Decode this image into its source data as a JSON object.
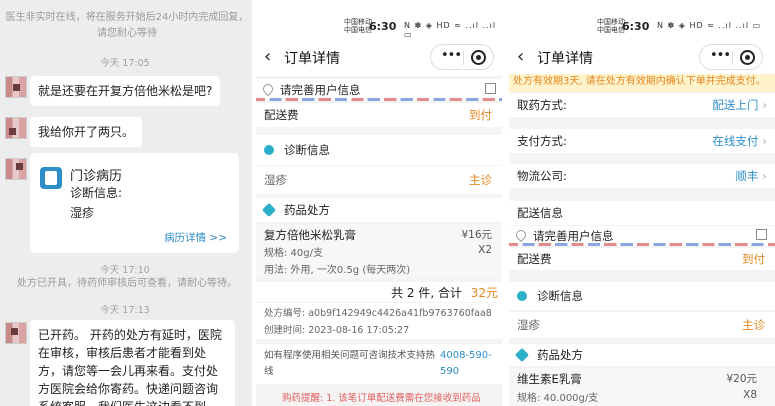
{
  "chat": {
    "notice": "医生非实时在线，将在服务开始后24小时内完成回复，请您耐心等待",
    "time1": "今天 17:05",
    "msg1": "就是还要在开复方倍他米松是吧?",
    "msg2": "我给你开了两只。",
    "card_title": "门诊病历",
    "card_label": "诊断信息:",
    "card_diag": "湿疹",
    "card_link": "病历详情 >>",
    "time2": "今天 17:10",
    "notice2": "处方已开具，待药师审核后可查看，请耐心等待。",
    "time3": "今天 17:13",
    "msg3": "已开药。 开药的处方有延时，医院在审核，审核后患者才能看到处方，请您等一会儿再来看。支付处方医院会给你寄药。快递问题咨询系统客服，我们医生这边看不到。系统提"
  },
  "status": {
    "carrier1": "中国移动",
    "carrier2": "中国电信",
    "time": "6:30",
    "icons": "N ✽ ◈ HD ≈ ..ıl ..ıl ▭"
  },
  "order": {
    "title": "订单详情",
    "back": "‹",
    "menu": "•••",
    "address": "请完善用户信息",
    "delivery_fee_label": "配送费",
    "delivery_fee_value": "到付",
    "diag_section": "诊断信息",
    "diag_name": "湿疹",
    "diag_tag": "主诊",
    "rx_section": "药品处方",
    "drug1_name": "复方倍他米松乳膏",
    "drug1_price": "¥16元",
    "drug1_spec": "规格: 40g/支",
    "drug1_qty": "X2",
    "drug1_usage": "用法: 外用, 一次0.5g (每天两次)",
    "total_label": "共 2 件, 合计",
    "total_value": "32元",
    "rx_no": "处方编号: a0b9f142949c4426a41fb9763760faa8",
    "created": "创建时间:   2023-08-16 17:05:27",
    "help_text": "如有程序使用相关问题可咨询技术支持热线",
    "help_phone": "4008-590-590",
    "reminder": "购药提醒: 1. 该笔订单配送费需在您接收到药品"
  },
  "order2": {
    "warning": "处方有效期3天, 请在处方有效期内确认下单并完成支付。",
    "pickup_label": "取药方式:",
    "pickup_value": "配送上门",
    "pay_label": "支付方式:",
    "pay_value": "在线支付",
    "logistics_label": "物流公司:",
    "logistics_value": "顺丰",
    "delivery_info": "配送信息",
    "drug_name": "维生素E乳膏",
    "drug_price": "¥20元",
    "drug_spec": "规格: 40.000g/支",
    "drug_qty": "X8"
  },
  "colors": {
    "accent": "#2e8ec8",
    "orange": "#e5861f",
    "cyan": "#2bb0c9"
  }
}
